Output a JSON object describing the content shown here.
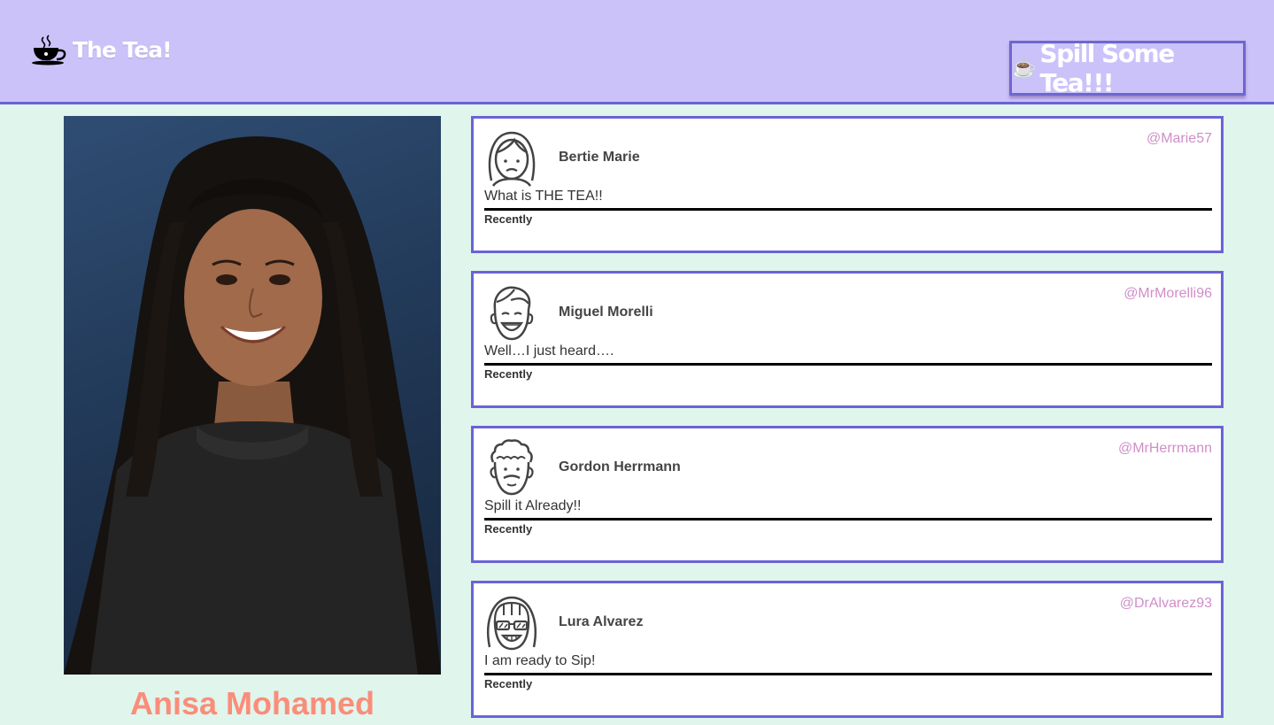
{
  "header": {
    "title": "The Tea!",
    "logo_icon": "teacup-icon",
    "spill_button": {
      "icon": "☕",
      "label": "Spill Some Tea!!!"
    }
  },
  "profile": {
    "name": "Anisa Mohamed",
    "photo_icon": "profile-photo"
  },
  "posts": [
    {
      "name": "Bertie Marie",
      "handle": "@Marie57",
      "message": "What is THE TEA!!",
      "time": "Recently",
      "avatar": "woman-avatar-icon"
    },
    {
      "name": "Miguel Morelli",
      "handle": "@MrMorelli96",
      "message": "Well…I just heard….",
      "time": "Recently",
      "avatar": "man-avatar-icon"
    },
    {
      "name": "Gordon Herrmann",
      "handle": "@MrHerrmann",
      "message": "Spill it Already!!",
      "time": "Recently",
      "avatar": "curly-man-avatar-icon"
    },
    {
      "name": "Lura Alvarez",
      "handle": "@DrAlvarez93",
      "message": "I am ready to Sip!",
      "time": "Recently",
      "avatar": "sunglasses-avatar-icon"
    }
  ],
  "colors": {
    "header_bg": "#cbc2f9",
    "page_bg": "#e0f5ec",
    "card_border": "#6a63d6",
    "handle": "#d08ec9",
    "profile_name": "#fa8d79"
  }
}
